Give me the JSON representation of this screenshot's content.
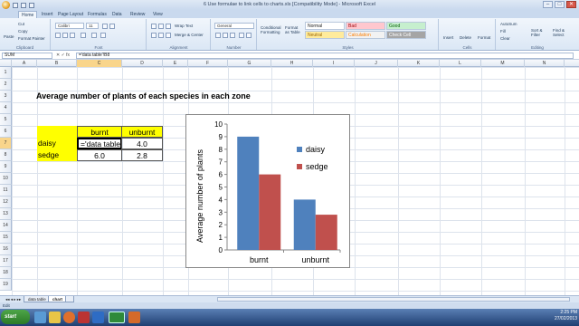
{
  "window": {
    "title": "6 Use formulae to link cells to charts.xls [Compatibility Mode] - Microsoft Excel",
    "controls": [
      "–",
      "□",
      "✕"
    ]
  },
  "tabs": [
    "Home",
    "Insert",
    "Page Layout",
    "Formulas",
    "Data",
    "Review",
    "View"
  ],
  "ribbon": {
    "clipboard": {
      "paste": "Paste",
      "cut": "Cut",
      "copy": "Copy",
      "format_painter": "Format Painter",
      "label": "Clipboard"
    },
    "font": {
      "name": "Calibri",
      "size": "11",
      "label": "Font"
    },
    "alignment": {
      "wrap": "Wrap Text",
      "merge": "Merge & Center",
      "label": "Alignment"
    },
    "number": {
      "format": "General",
      "label": "Number"
    },
    "styles": {
      "conditional": "Conditional Formatting",
      "format_table": "Format as Table",
      "normal": "Normal",
      "bad": "Bad",
      "good": "Good",
      "neutral": "Neutral",
      "calculation": "Calculation",
      "check_cell": "Check Cell",
      "label": "Styles"
    },
    "cells": {
      "insert": "Insert",
      "delete": "Delete",
      "format": "Format",
      "label": "Cells"
    },
    "editing": {
      "autosum": "AutoSum",
      "fill": "Fill",
      "clear": "Clear",
      "sort": "Sort & Filter",
      "find": "Find & Select",
      "label": "Editing"
    }
  },
  "formula_bar": {
    "name_box": "SUM",
    "fx": "✕ ✓ fx",
    "content": "='data table'!B8"
  },
  "columns": [
    "A",
    "B",
    "C",
    "D",
    "E",
    "F",
    "G",
    "H",
    "I",
    "J",
    "K",
    "L",
    "M",
    "N"
  ],
  "rows": [
    "1",
    "2",
    "3",
    "4",
    "5",
    "6",
    "7",
    "8",
    "9",
    "10",
    "11",
    "12",
    "13",
    "14",
    "15",
    "16",
    "17",
    "18",
    "19"
  ],
  "sheet": {
    "title": "Average number of plants of each species in each zone",
    "header": [
      "burnt",
      "unburnt"
    ],
    "rows": [
      {
        "label": "daisy",
        "burnt": "='data table",
        "unburnt": "4.0"
      },
      {
        "label": "sedge",
        "burnt": "6.0",
        "unburnt": "2.8"
      }
    ]
  },
  "chart_data": {
    "type": "bar",
    "categories": [
      "burnt",
      "unburnt"
    ],
    "series": [
      {
        "name": "daisy",
        "values": [
          9,
          4
        ],
        "color": "#4f81bd"
      },
      {
        "name": "sedge",
        "values": [
          6,
          2.8
        ],
        "color": "#c0504d"
      }
    ],
    "ylabel": "Average number of plants",
    "xlabel": "",
    "ylim": [
      0,
      10
    ],
    "yticks": [
      0,
      1,
      2,
      3,
      4,
      5,
      6,
      7,
      8,
      9,
      10
    ],
    "legend": "right",
    "grid": false
  },
  "sheet_tabs": [
    "data table",
    "chart"
  ],
  "status": "Edit",
  "tray": {
    "time": "2:25 PM",
    "date": "27/02/2013"
  }
}
